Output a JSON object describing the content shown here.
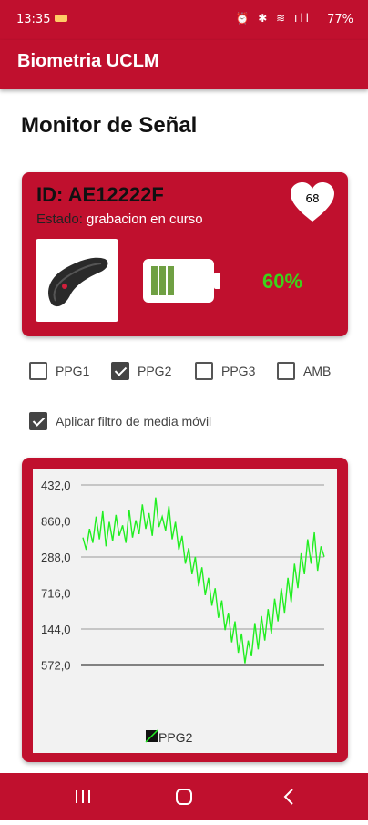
{
  "status_bar": {
    "time": "13:35",
    "icons": "⏰ ✱ ≋ ıll",
    "battery": "77%"
  },
  "app": {
    "title": "Biometria UCLM"
  },
  "page": {
    "heading": "Monitor de Señal"
  },
  "device_card": {
    "id": "ID: AE12222F",
    "estado_label": "Estado:",
    "estado_value": "grabacion en curso",
    "heart_rate": "68",
    "battery_level": 0.6,
    "battery_text": "60%",
    "colors": {
      "card": "#c0102e",
      "battery_fill": "#6fa043",
      "percent": "#3dd21a"
    }
  },
  "sensors": [
    {
      "label": "PPG1",
      "checked": false
    },
    {
      "label": "PPG2",
      "checked": true
    },
    {
      "label": "PPG3",
      "checked": false
    },
    {
      "label": "AMB",
      "checked": false
    }
  ],
  "filter": {
    "label": "Aplicar filtro de media móvil",
    "checked": true
  },
  "chart_data": {
    "type": "line",
    "y_tick_labels": [
      "432,0",
      "860,0",
      "288,0",
      "716,0",
      "144,0",
      "572,0"
    ],
    "series": [
      {
        "name": "PPG2",
        "color": "#22ee22",
        "y": [
          0.73,
          0.66,
          0.78,
          0.7,
          0.85,
          0.72,
          0.88,
          0.68,
          0.82,
          0.71,
          0.86,
          0.74,
          0.8,
          0.7,
          0.89,
          0.73,
          0.83,
          0.75,
          0.92,
          0.78,
          0.87,
          0.74,
          0.96,
          0.79,
          0.85,
          0.77,
          0.91,
          0.72,
          0.82,
          0.66,
          0.74,
          0.58,
          0.67,
          0.52,
          0.62,
          0.45,
          0.56,
          0.4,
          0.5,
          0.34,
          0.44,
          0.27,
          0.37,
          0.2,
          0.3,
          0.13,
          0.25,
          0.07,
          0.18,
          0.01,
          0.14,
          0.05,
          0.24,
          0.09,
          0.28,
          0.14,
          0.32,
          0.18,
          0.38,
          0.25,
          0.44,
          0.3,
          0.5,
          0.36,
          0.58,
          0.44,
          0.64,
          0.52,
          0.72,
          0.58,
          0.76,
          0.54,
          0.68,
          0.62
        ]
      }
    ],
    "legend": [
      "PPG2"
    ],
    "grid": true
  }
}
